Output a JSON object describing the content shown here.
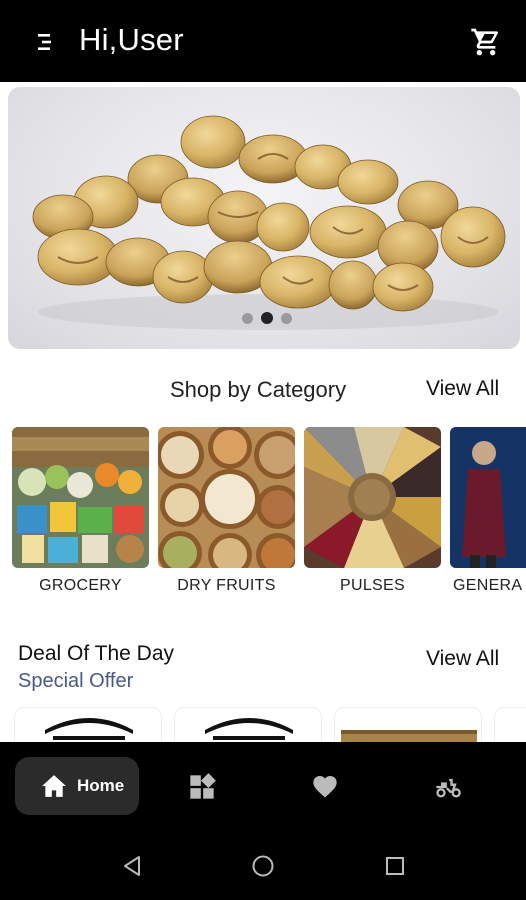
{
  "header": {
    "title": "Hi,User",
    "menu_icon": "menu-icon",
    "cart_icon": "cart-icon"
  },
  "banner": {
    "image": "pistachios",
    "slides": 3,
    "active_slide": 2
  },
  "categories": {
    "title": "Shop by Category",
    "view_all": "View All",
    "items": [
      {
        "label": "GROCERY"
      },
      {
        "label": "DRY FRUITS"
      },
      {
        "label": "PULSES"
      },
      {
        "label": "GENERA"
      }
    ]
  },
  "deals": {
    "title": "Deal Of The Day",
    "subtitle": "Special Offer",
    "view_all": "View All"
  },
  "bottom_nav": {
    "home_label": "Home",
    "items": [
      "home-icon",
      "dashboard-icon",
      "heart-icon",
      "delivery-scooter-icon"
    ]
  },
  "system_nav": [
    "back-icon",
    "home-circle-icon",
    "recents-icon"
  ],
  "colors": {
    "bar": "#000000",
    "nav_active": "#2b2b2b",
    "subtitle": "#4a5a88"
  }
}
